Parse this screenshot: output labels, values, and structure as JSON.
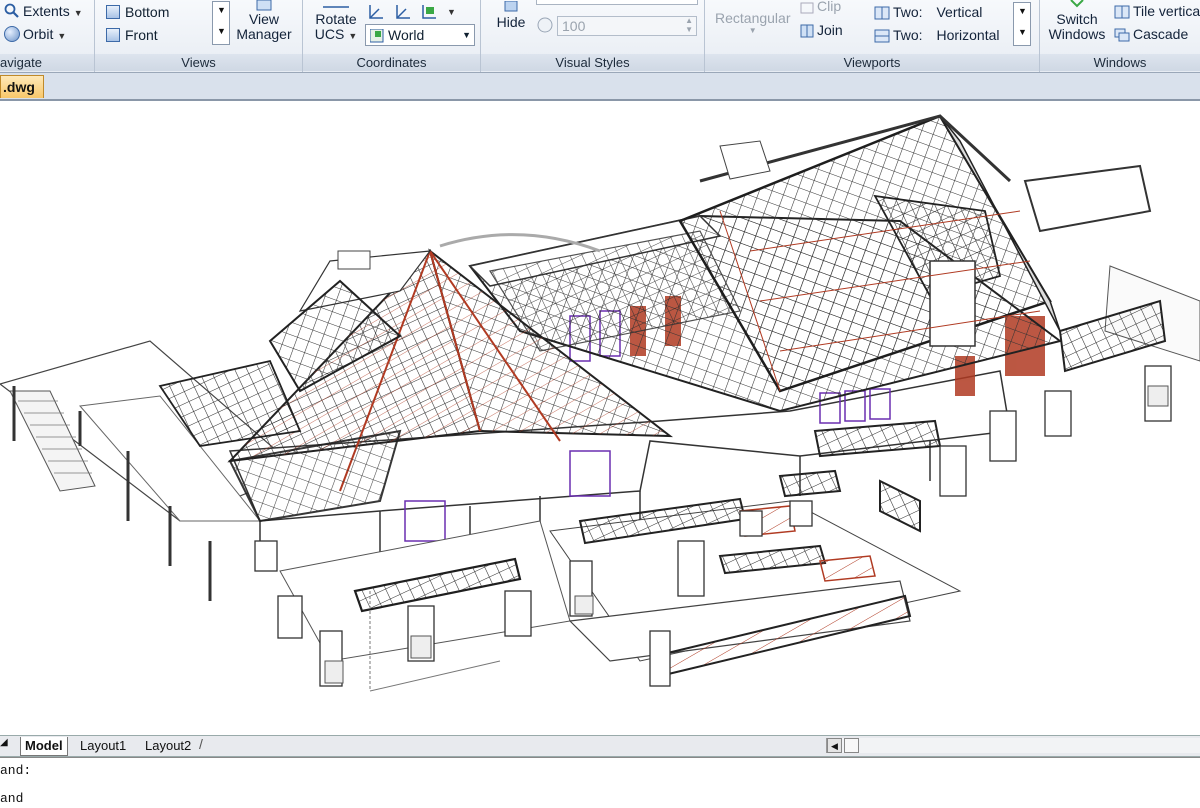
{
  "ribbon": {
    "navigate": {
      "extents": "Extents",
      "orbit": "Orbit",
      "title": "avigate"
    },
    "views": {
      "bottom": "Bottom",
      "front": "Front",
      "view_manager_line1": "View",
      "view_manager_line2": "Manager",
      "title": "Views"
    },
    "coordinates": {
      "rotate_line1": "Rotate",
      "rotate_line2": "UCS",
      "world": "World",
      "title": "Coordinates"
    },
    "visual_styles": {
      "hide": "Hide",
      "opacity_value": "100",
      "title": "Visual Styles"
    },
    "viewports": {
      "rectangular": "Rectangular",
      "clip": "Clip",
      "join": "Join",
      "two_vertical_a": "Two:",
      "two_vertical_b": "Vertical",
      "two_horizontal_a": "Two:",
      "two_horizontal_b": "Horizontal",
      "title": "Viewports"
    },
    "windows": {
      "switch_line1": "Switch",
      "switch_line2": "Windows",
      "tile": "Tile vertica",
      "cascade": "Cascade",
      "title": "Windows"
    }
  },
  "file_tab": {
    "label": ".dwg"
  },
  "layout_tabs": {
    "model": "Model",
    "layout1": "Layout1",
    "layout2": "Layout2"
  },
  "command": {
    "line1": "and:",
    "line2": "and"
  },
  "colors": {
    "roof_red": "#b03a22",
    "frame": "#2b2b2b",
    "glass": "#6a2fb0"
  }
}
